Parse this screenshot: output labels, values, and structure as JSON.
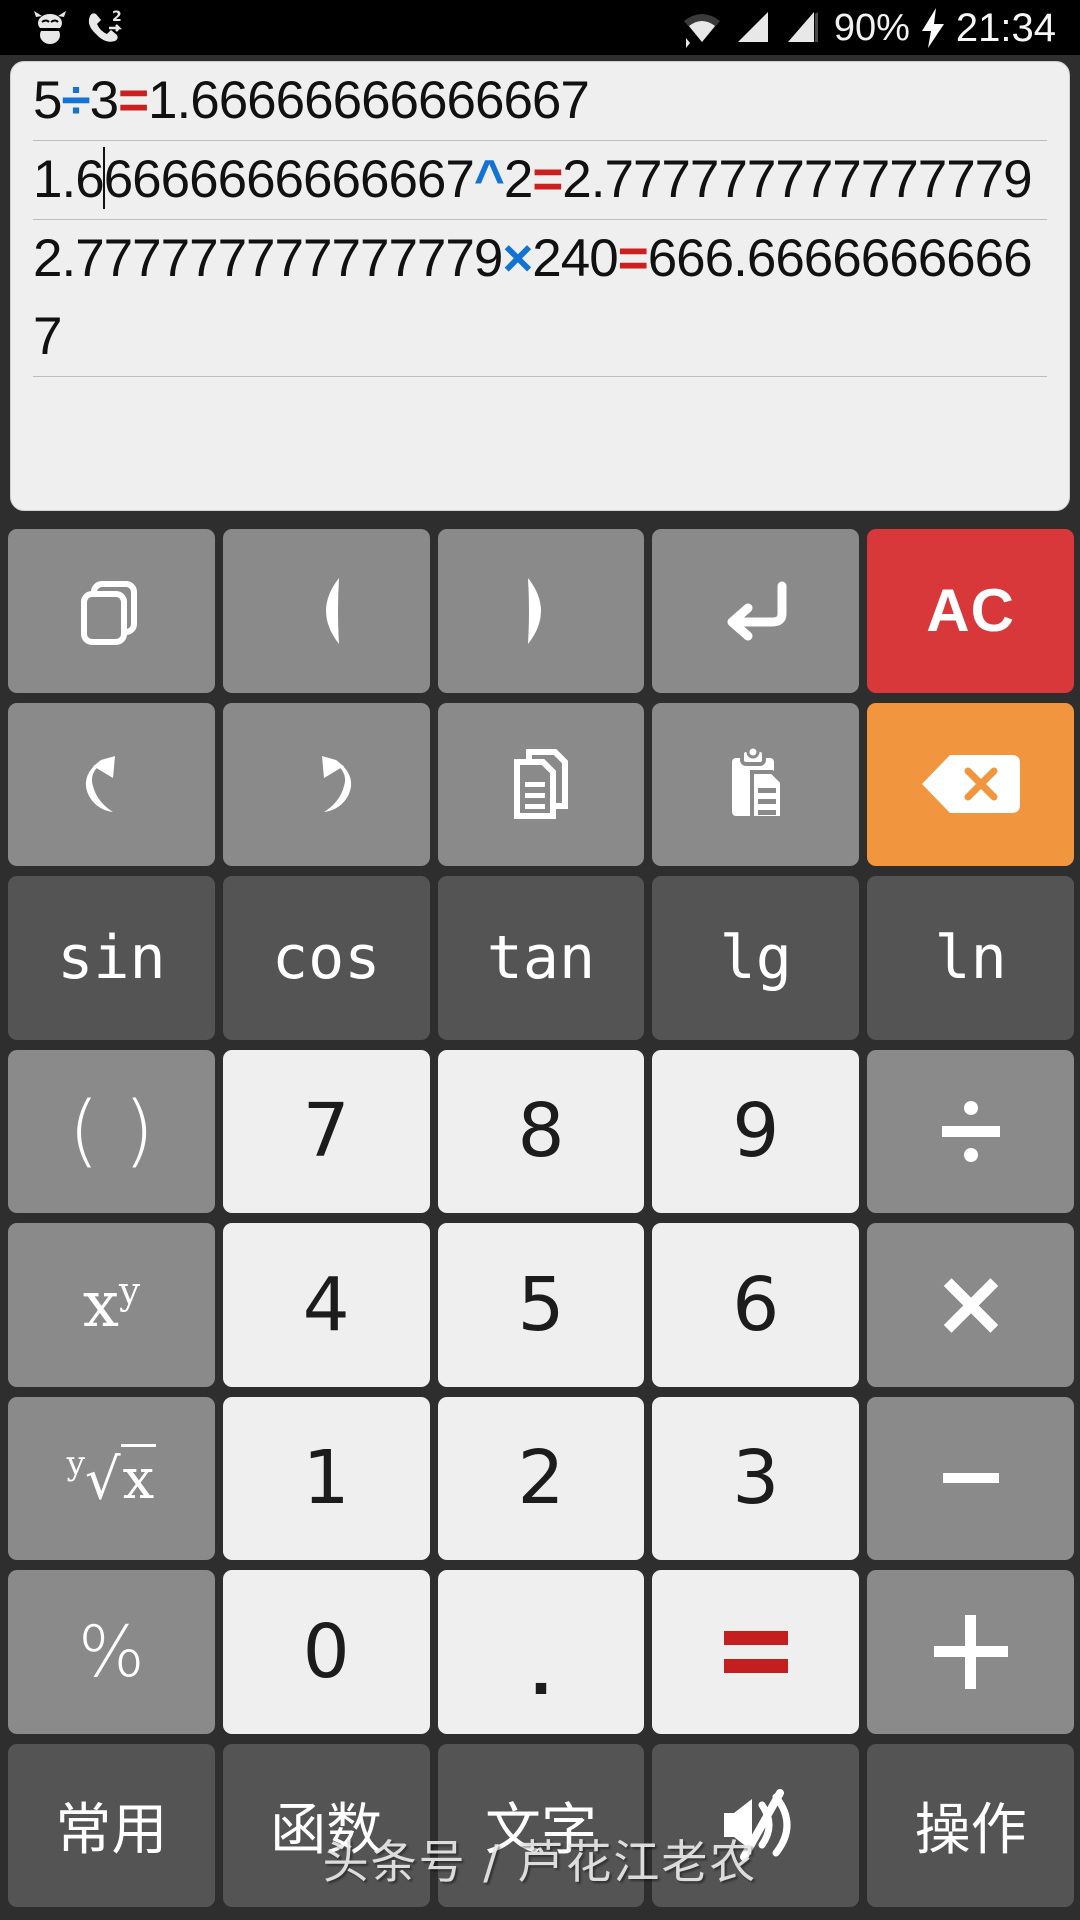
{
  "status_bar": {
    "icons_left": [
      "cow-icon",
      "missed-call-icon"
    ],
    "missed_call_count": "2",
    "icons_right": [
      "wifi-icon",
      "signal-1-icon",
      "signal-2-icon"
    ],
    "battery_percent": "90%",
    "charging_icon": "charging-bolt-icon",
    "clock": "21:34"
  },
  "display": {
    "entries": [
      {
        "pre": "5",
        "op1": "÷",
        "mid": "3",
        "op2": "=",
        "post": "1.66666666666667",
        "caret_after": null
      },
      {
        "pre": "1.6",
        "caret_after": "1.6",
        "mid2": "6666666666667",
        "op1": "^",
        "mid": "2",
        "op2": "=",
        "post": "2.777777777777779"
      },
      {
        "pre": "2.777777777777779",
        "op1": "×",
        "mid": "240",
        "op2": "=",
        "post": "666.66666666667"
      }
    ],
    "line1_full": "5÷3=1.66666666666667",
    "line2_full": "1.66666666666667^2=2.777777777777779",
    "line3_full": "2.777777777777779×240=666.66666666667",
    "caret_position_text": "1.6"
  },
  "keypad": {
    "rows": [
      {
        "style": "icon",
        "keys": [
          {
            "name": "window-switch-button",
            "icon": "windows-stack-icon",
            "label": "",
            "color": "gray"
          },
          {
            "name": "cursor-left-button",
            "icon": "triangle-left-icon",
            "label": "",
            "color": "gray"
          },
          {
            "name": "cursor-right-button",
            "icon": "triangle-right-icon",
            "label": "",
            "color": "gray"
          },
          {
            "name": "newline-button",
            "icon": "enter-return-icon",
            "label": "",
            "color": "gray"
          },
          {
            "name": "all-clear-button",
            "icon": "",
            "label": "AC",
            "color": "red"
          }
        ]
      },
      {
        "style": "icon",
        "keys": [
          {
            "name": "undo-button",
            "icon": "undo-arrow-icon",
            "label": "",
            "color": "gray"
          },
          {
            "name": "redo-button",
            "icon": "redo-arrow-icon",
            "label": "",
            "color": "gray"
          },
          {
            "name": "copy-button",
            "icon": "copy-documents-icon",
            "label": "",
            "color": "gray"
          },
          {
            "name": "paste-button",
            "icon": "clipboard-paste-icon",
            "label": "",
            "color": "gray"
          },
          {
            "name": "backspace-button",
            "icon": "backspace-delete-icon",
            "label": "",
            "color": "orange"
          }
        ]
      },
      {
        "style": "fn",
        "keys": [
          {
            "name": "sin-button",
            "label": "sin",
            "color": "dark"
          },
          {
            "name": "cos-button",
            "label": "cos",
            "color": "dark"
          },
          {
            "name": "tan-button",
            "label": "tan",
            "color": "dark"
          },
          {
            "name": "lg-button",
            "label": "lg",
            "color": "dark"
          },
          {
            "name": "ln-button",
            "label": "ln",
            "color": "dark"
          }
        ]
      },
      {
        "style": "num",
        "keys": [
          {
            "name": "parentheses-button",
            "label": "( )",
            "color": "gray"
          },
          {
            "name": "digit-7-button",
            "label": "7",
            "color": "white"
          },
          {
            "name": "digit-8-button",
            "label": "8",
            "color": "white"
          },
          {
            "name": "digit-9-button",
            "label": "9",
            "color": "white"
          },
          {
            "name": "divide-button",
            "label": "÷",
            "color": "gray"
          }
        ]
      },
      {
        "style": "num",
        "keys": [
          {
            "name": "power-button",
            "label": "x^y",
            "color": "gray"
          },
          {
            "name": "digit-4-button",
            "label": "4",
            "color": "white"
          },
          {
            "name": "digit-5-button",
            "label": "5",
            "color": "white"
          },
          {
            "name": "digit-6-button",
            "label": "6",
            "color": "white"
          },
          {
            "name": "multiply-button",
            "label": "×",
            "color": "gray"
          }
        ]
      },
      {
        "style": "num",
        "keys": [
          {
            "name": "nth-root-button",
            "label": "y√x",
            "color": "gray"
          },
          {
            "name": "digit-1-button",
            "label": "1",
            "color": "white"
          },
          {
            "name": "digit-2-button",
            "label": "2",
            "color": "white"
          },
          {
            "name": "digit-3-button",
            "label": "3",
            "color": "white"
          },
          {
            "name": "minus-button",
            "label": "−",
            "color": "gray"
          }
        ]
      },
      {
        "style": "num",
        "keys": [
          {
            "name": "percent-button",
            "label": "%",
            "color": "gray"
          },
          {
            "name": "digit-0-button",
            "label": "0",
            "color": "white"
          },
          {
            "name": "decimal-point-button",
            "label": ".",
            "color": "white"
          },
          {
            "name": "equals-button",
            "label": "=",
            "color": "white"
          },
          {
            "name": "plus-button",
            "label": "+",
            "color": "gray"
          }
        ]
      },
      {
        "style": "cjk",
        "keys": [
          {
            "name": "tab-common-button",
            "label": "常用",
            "color": "dark"
          },
          {
            "name": "tab-functions-button",
            "label": "函数",
            "color": "dark"
          },
          {
            "name": "tab-text-button",
            "label": "文字",
            "color": "dark"
          },
          {
            "name": "tab-sound-button",
            "label": "",
            "icon": "speaker-mute-icon",
            "color": "dark"
          },
          {
            "name": "tab-operations-button",
            "label": "操作",
            "color": "dark"
          }
        ]
      }
    ]
  },
  "watermark": {
    "text": "头条号 / 芦花江老农"
  },
  "colors": {
    "accent_clear": "#d9383b",
    "accent_backspace": "#f2953f",
    "key_gray": "#8a8a8a",
    "key_dark": "#545454",
    "key_white": "#efefef",
    "operator_blue": "#1273d4",
    "operator_red": "#cc1f1f",
    "background": "#2e2e2e",
    "display_bg": "#efefef"
  }
}
